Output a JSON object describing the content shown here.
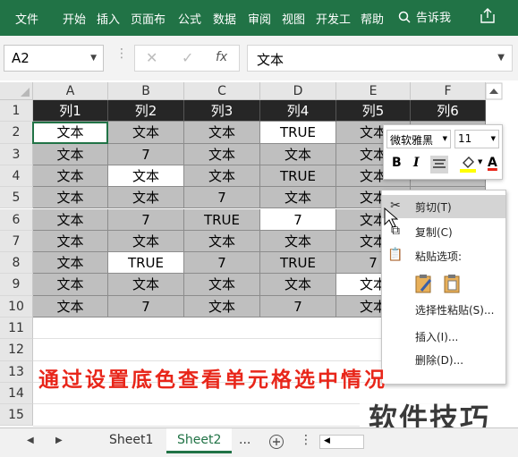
{
  "ribbon": {
    "tabs": [
      "文件",
      "开始",
      "插入",
      "页面布",
      "公式",
      "数据",
      "审阅",
      "视图",
      "开发工",
      "帮助"
    ],
    "tell_me": "告诉我"
  },
  "formula_bar": {
    "name_box": "A2",
    "content": "文本",
    "fx": "fx"
  },
  "columns": [
    "A",
    "B",
    "C",
    "D",
    "E",
    "F"
  ],
  "rows": [
    "1",
    "2",
    "3",
    "4",
    "5",
    "6",
    "7",
    "8",
    "9",
    "10",
    "11",
    "12",
    "13",
    "14",
    "15"
  ],
  "table": {
    "header": [
      "列1",
      "列2",
      "列3",
      "列4",
      "列5",
      "列6"
    ],
    "body": [
      [
        "文本",
        "文本",
        "文本",
        "TRUE",
        "文本",
        ""
      ],
      [
        "文本",
        "7",
        "文本",
        "文本",
        "文本",
        ""
      ],
      [
        "文本",
        "文本",
        "文本",
        "TRUE",
        "文本",
        ""
      ],
      [
        "文本",
        "文本",
        "7",
        "文本",
        "文本",
        ""
      ],
      [
        "文本",
        "7",
        "TRUE",
        "7",
        "文本",
        ""
      ],
      [
        "文本",
        "文本",
        "文本",
        "文本",
        "文本",
        ""
      ],
      [
        "文本",
        "TRUE",
        "7",
        "TRUE",
        "7",
        ""
      ],
      [
        "文本",
        "文本",
        "文本",
        "文本",
        "文本",
        ""
      ],
      [
        "文本",
        "7",
        "文本",
        "7",
        "文本",
        ""
      ]
    ],
    "white_cells": [
      [
        0,
        0
      ],
      [
        0,
        3
      ],
      [
        2,
        1
      ],
      [
        4,
        3
      ],
      [
        6,
        1
      ],
      [
        7,
        4
      ]
    ]
  },
  "mini_toolbar": {
    "font": "微软雅黑",
    "size": "11",
    "bold": "B",
    "italic": "I",
    "font_color": "A"
  },
  "context_menu": {
    "cut": "剪切(T)",
    "copy": "复制(C)",
    "paste_options": "粘贴选项:",
    "paste_special": "选择性粘贴(S)...",
    "insert": "插入(I)...",
    "delete": "删除(D)..."
  },
  "overlay_text": "通过设置底色查看单元格选中情况",
  "watermark": "软件技巧",
  "sheets": {
    "tabs": [
      "Sheet1",
      "Sheet2"
    ],
    "active": "Sheet2",
    "more": "..."
  },
  "colors": {
    "accent": "#217346",
    "header_fill": "#262626",
    "cell_grey": "#bfbfbf",
    "overlay_red": "#e8261a"
  }
}
